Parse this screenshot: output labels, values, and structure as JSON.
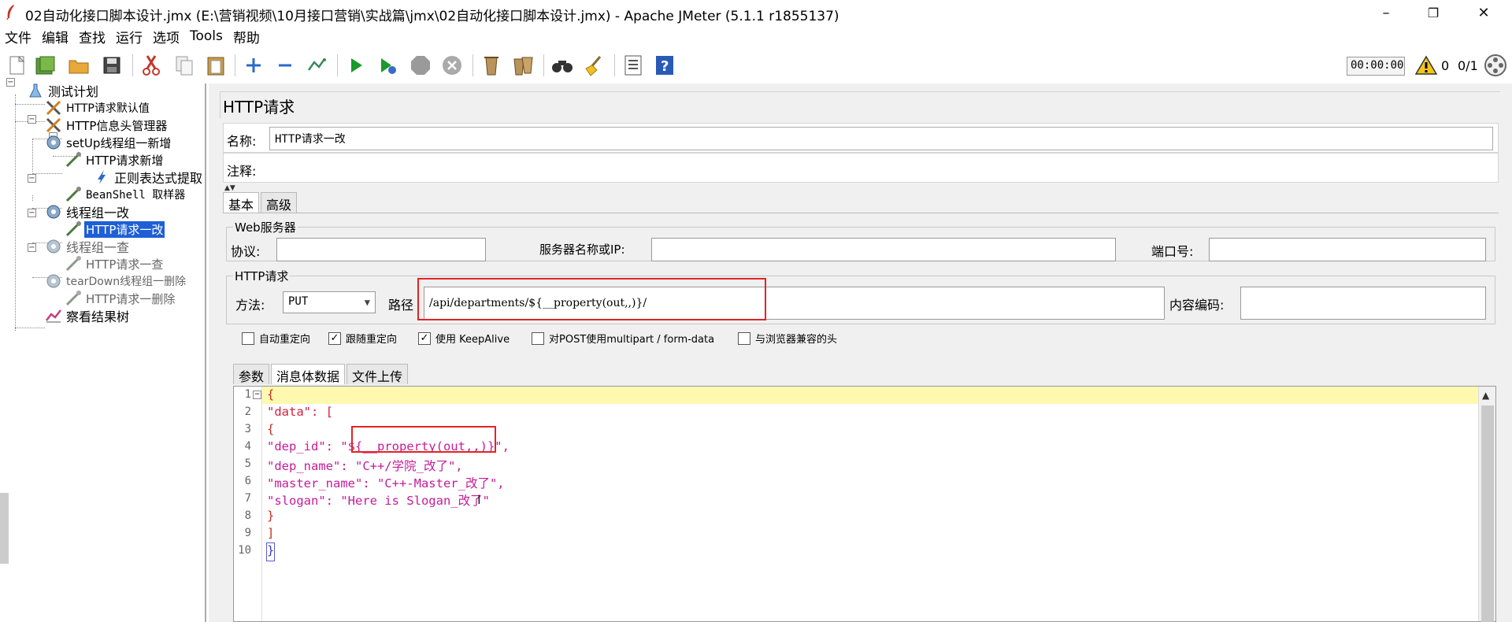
{
  "window": {
    "title": "02自动化接口脚本设计.jmx (E:\\营销视频\\10月接口营销\\实战篇\\jmx\\02自动化接口脚本设计.jmx) - Apache JMeter (5.1.1 r1855137)",
    "minimize": "–",
    "maximize": "❐",
    "close": "✕"
  },
  "menu": [
    "文件",
    "编辑",
    "查找",
    "运行",
    "选项",
    "Tools",
    "帮助"
  ],
  "toolbar": {
    "timer": "00:00:00",
    "warnings": "0",
    "threads": "0/1"
  },
  "tree": [
    {
      "label": "测试计划",
      "icon": "flask-icon"
    },
    {
      "label": "HTTP请求默认值",
      "icon": "wrench-icon"
    },
    {
      "label": "HTTP信息头管理器",
      "icon": "wrench-icon"
    },
    {
      "label": "setUp线程组一新增",
      "icon": "gear-icon"
    },
    {
      "label": "HTTP请求新增",
      "icon": "pipette-icon"
    },
    {
      "label": "正则表达式提取",
      "icon": "extractor-icon"
    },
    {
      "label": "BeanShell 取样器",
      "icon": "pipette-icon"
    },
    {
      "label": "线程组一改",
      "icon": "gear-icon"
    },
    {
      "label": "HTTP请求一改",
      "icon": "pipette-icon"
    },
    {
      "label": "线程组一查",
      "icon": "gear-icon"
    },
    {
      "label": "HTTP请求一查",
      "icon": "pipette-icon"
    },
    {
      "label": "tearDown线程组一删除",
      "icon": "gear-icon"
    },
    {
      "label": "HTTP请求一删除",
      "icon": "pipette-icon"
    },
    {
      "label": "察看结果树",
      "icon": "chart-icon"
    }
  ],
  "panel": {
    "title": "HTTP请求",
    "name_label": "名称:",
    "name_value": "HTTP请求一改",
    "comment_label": "注释:",
    "comment_value": "",
    "tabs": [
      "基本",
      "高级"
    ],
    "web_server": {
      "title": "Web服务器",
      "protocol_label": "协议:",
      "protocol_value": "",
      "server_label": "服务器名称或IP:",
      "server_value": "",
      "port_label": "端口号:",
      "port_value": ""
    },
    "http_request": {
      "title": "HTTP请求",
      "method_label": "方法:",
      "method_value": "PUT",
      "path_label": "路径",
      "path_value": "/api/departments/${__property(out,,)}/",
      "encoding_label": "内容编码:",
      "encoding_value": ""
    },
    "checkboxes": [
      {
        "label": "自动重定向",
        "checked": false
      },
      {
        "label": "跟随重定向",
        "checked": true
      },
      {
        "label": "使用 KeepAlive",
        "checked": true
      },
      {
        "label": "对POST使用multipart / form-data",
        "checked": false
      },
      {
        "label": "与浏览器兼容的头",
        "checked": false
      }
    ],
    "body_tabs": [
      "参数",
      "消息体数据",
      "文件上传"
    ],
    "code_lines": [
      "{",
      "\"data\": [",
      "{",
      "\"dep_id\": \"${__property(out,,)}\",",
      "\"dep_name\": \"C++/学院_改了\",",
      "\"master_name\": \"C++-Master_改了\",",
      "\"slogan\": \"Here is Slogan_改了\"",
      "}",
      "]",
      "}"
    ]
  }
}
